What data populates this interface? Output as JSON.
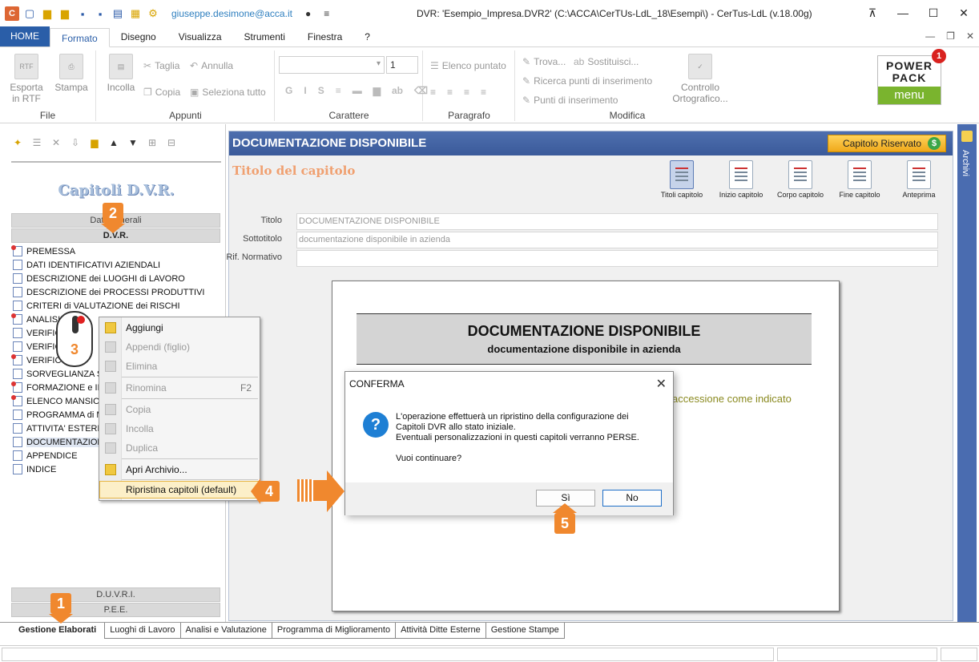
{
  "titlebar": {
    "user_email": "giuseppe.desimone@acca.it",
    "window_title": "DVR: 'Esempio_Impresa.DVR2'   (C:\\ACCA\\CerTUs-LdL_18\\Esempi\\) - CerTus-LdL (v.18.00g)",
    "app_logo": "C"
  },
  "ribbon_tabs": [
    "HOME",
    "Formato",
    "Disegno",
    "Visualizza",
    "Strumenti",
    "Finestra",
    "?"
  ],
  "ribbon": {
    "file": {
      "label": "File",
      "export_rtf": "Esporta in RTF",
      "rtf_icon": "RTF",
      "print": "Stampa"
    },
    "appunti": {
      "label": "Appunti",
      "paste": "Incolla",
      "cut": "Taglia",
      "undo": "Annulla",
      "copy": "Copia",
      "select_all": "Seleziona tutto"
    },
    "carattere": {
      "label": "Carattere",
      "font_size": "1",
      "bold": "G",
      "italic": "I",
      "underline": "S"
    },
    "paragrafo": {
      "label": "Paragrafo",
      "bullet_list": "Elenco puntato"
    },
    "modifica": {
      "label": "Modifica",
      "find": "Trova...",
      "replace": "Sostituisci...",
      "search_points": "Ricerca punti di inserimento",
      "insert_points": "Punti di inserimento",
      "spellcheck": "Controllo Ortografico..."
    },
    "power_pack": {
      "line1": "POWER",
      "line2": "PACK",
      "menu": "menu",
      "badge": "1"
    }
  },
  "left_panel": {
    "title": "Capitoli  D.V.R.",
    "section_top": "Dati Generali",
    "section_dvr": "D.V.R.",
    "chapters": [
      "PREMESSA",
      "DATI IDENTIFICATIVI AZIENDALI",
      "DESCRIZIONE dei LUOGHI di LAVORO",
      "DESCRIZIONE dei PROCESSI PRODUTTIVI",
      "CRITERI di VALUTAZIONE dei RISCHI",
      "ANALISI",
      "VERIFIC",
      "VERIFIC",
      "VERIFIC",
      "SORVEGLIANZA SA",
      "FORMAZIONE e IN",
      "ELENCO MANSION",
      "PROGRAMMA di M",
      "ATTIVITA' ESTERN",
      "DOCUMENTAZION",
      "APPENDICE",
      "INDICE"
    ],
    "section_duvri": "D.U.V.R.I.",
    "section_pee": "P.E.E."
  },
  "right_panel": {
    "header": "DOCUMENTAZIONE DISPONIBILE",
    "reserved_button": "Capitolo Riservato",
    "reserved_icon": "$",
    "subtitle": "Titolo del capitolo",
    "tools": [
      "Titoli capitolo",
      "Inizio capitolo",
      "Corpo capitolo",
      "Fine capitolo",
      "Anteprima"
    ],
    "fields": {
      "title_label": "Titolo",
      "title_value": "DOCUMENTAZIONE DISPONIBILE",
      "subtitle_label": "Sottotitolo",
      "subtitle_value": "documentazione disponibile in azienda",
      "rif_label": "Rif. Normativo",
      "rif_value": ""
    },
    "preview": {
      "heading": "DOCUMENTAZIONE DISPONIBILE",
      "subheading": "documentazione disponibile in azienda",
      "body_fragment": "accessione come indicato"
    }
  },
  "archivi_label": "Archivi",
  "context_menu": {
    "items": [
      {
        "label": "Aggiungi",
        "shortcut": ""
      },
      {
        "label": "Appendi (figlio)",
        "shortcut": ""
      },
      {
        "label": "Elimina",
        "shortcut": ""
      },
      {
        "label": "Rinomina",
        "shortcut": "F2"
      },
      {
        "label": "Copia",
        "shortcut": ""
      },
      {
        "label": "Incolla",
        "shortcut": ""
      },
      {
        "label": "Duplica",
        "shortcut": ""
      },
      {
        "label": "Apri Archivio...",
        "shortcut": ""
      },
      {
        "label": "Ripristina capitoli (default)",
        "shortcut": ""
      }
    ]
  },
  "dialog": {
    "title": "CONFERMA",
    "close": "✕",
    "icon": "?",
    "line1": "L'operazione effettuerà un ripristino della configurazione dei",
    "line2": "Capitoli DVR allo stato iniziale.",
    "line3": "Eventuali personalizzazioni in questi capitoli verranno PERSE.",
    "line4": "Vuoi continuare?",
    "yes": "Sì",
    "no": "No"
  },
  "bottom_tabs": [
    "Gestione Elaborati",
    "Luoghi di Lavoro",
    "Analisi e Valutazione",
    "Programma di Miglioramento",
    "Attività Ditte Esterne",
    "Gestione Stampe"
  ],
  "callouts": [
    "1",
    "2",
    "3",
    "4",
    "5"
  ],
  "colors": {
    "accent": "#2a5ea8",
    "callout": "#f0882e",
    "header": "#4e6fae",
    "powerpack": "#7ab42e"
  }
}
